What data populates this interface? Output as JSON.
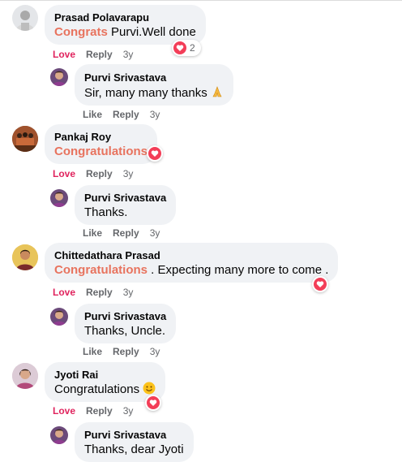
{
  "colors": {
    "bubble_bg": "#f0f2f5",
    "highlight": "#e8735e",
    "love": "#e0245e",
    "meta": "#65676b",
    "heart": "#f33e58"
  },
  "comments": [
    {
      "author": "Prasad Polavarapu",
      "highlight": "Congrats",
      "text": " Purvi.Well done",
      "reaction": {
        "icon": "heart-icon",
        "count": "2"
      },
      "actions": {
        "love": "Love",
        "reply": "Reply",
        "time": "3y"
      },
      "reply": {
        "author": "Purvi Srivastava",
        "text": "Sir, many many thanks",
        "emoji": "folded-hands-icon",
        "actions": {
          "like": "Like",
          "reply": "Reply",
          "time": "3y"
        }
      }
    },
    {
      "author": "Pankaj Roy",
      "highlight": "Congratulations",
      "text": "",
      "reaction": {
        "icon": "heart-icon"
      },
      "actions": {
        "love": "Love",
        "reply": "Reply",
        "time": "3y"
      },
      "reply": {
        "author": "Purvi Srivastava",
        "text": "Thanks.",
        "actions": {
          "like": "Like",
          "reply": "Reply",
          "time": "3y"
        }
      }
    },
    {
      "author": "Chittedathara Prasad",
      "highlight": "Congratulations",
      "text": " . Expecting many more to come .",
      "reaction": {
        "icon": "heart-icon"
      },
      "actions": {
        "love": "Love",
        "reply": "Reply",
        "time": "3y"
      },
      "reply": {
        "author": "Purvi Srivastava",
        "text": "Thanks, Uncle.",
        "actions": {
          "like": "Like",
          "reply": "Reply",
          "time": "3y"
        }
      }
    },
    {
      "author": "Jyoti Rai",
      "text": "Congratulations",
      "emoji": "smiling-face-icon",
      "reaction": {
        "icon": "heart-icon"
      },
      "actions": {
        "love": "Love",
        "reply": "Reply",
        "time": "3y"
      },
      "reply": {
        "author": "Purvi Srivastava",
        "text": "Thanks, dear Jyoti"
      }
    }
  ]
}
